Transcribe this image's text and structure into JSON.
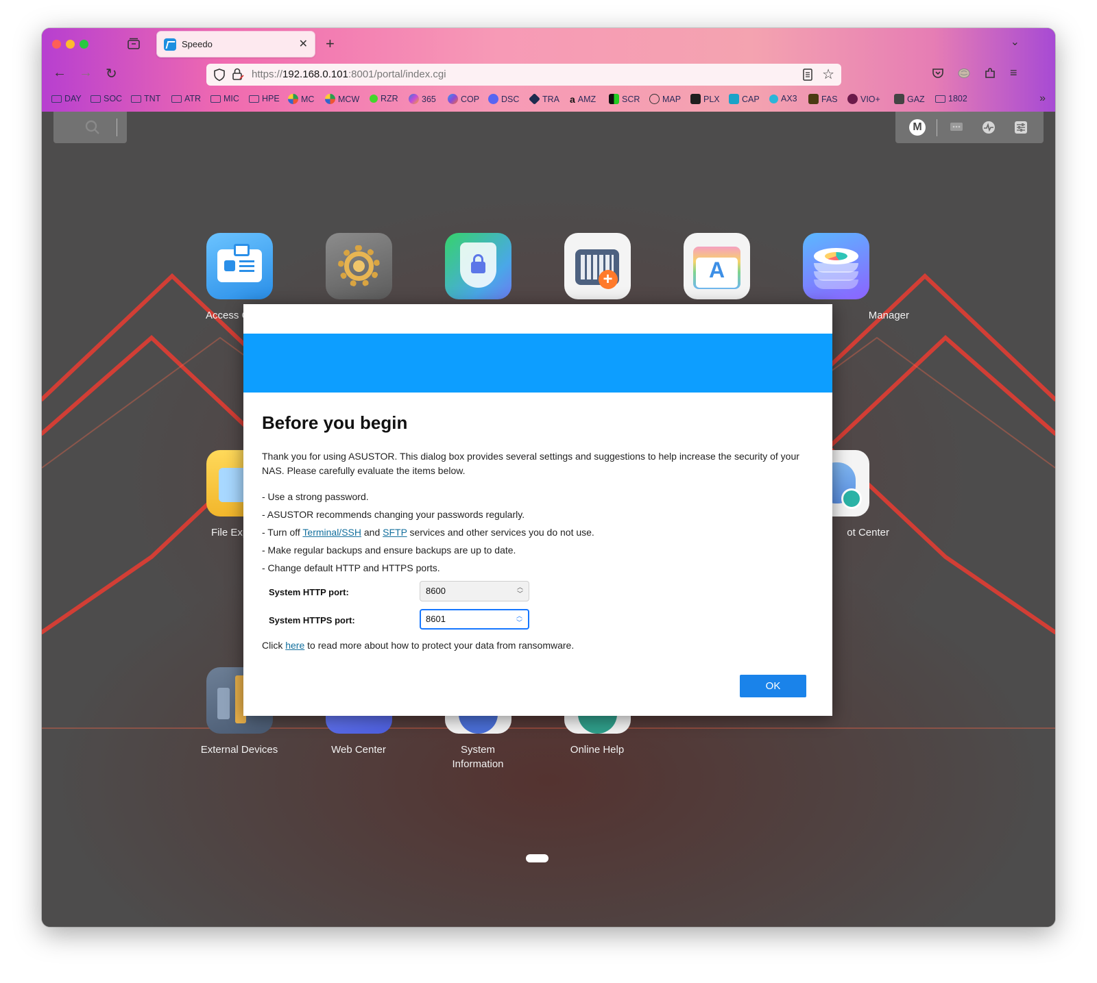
{
  "browser": {
    "tab_title": "Speedo",
    "url_prefix": "https://",
    "url_host": "192.168.0.101",
    "url_rest": ":8001/portal/index.cgi",
    "bookmarks": [
      "DAY",
      "SOC",
      "TNT",
      "ATR",
      "MIC",
      "HPE",
      "MC",
      "MCW",
      "RZR",
      "365",
      "COP",
      "DSC",
      "TRA",
      "AMZ",
      "SCR",
      "MAP",
      "PLX",
      "CAP",
      "AX3",
      "FAS",
      "VIO+",
      "GAZ",
      "1802"
    ]
  },
  "desktop": {
    "user_initial": "M",
    "apps_row1": [
      "Access C",
      "",
      "",
      "",
      "",
      "Manager"
    ],
    "apps_row2": [
      "File Exp",
      "ot Center"
    ],
    "apps_row3": [
      "External Devices",
      "Web Center",
      "System Information",
      "Online Help"
    ]
  },
  "dialog": {
    "title": "Before you begin",
    "intro": "Thank you for using ASUSTOR. This dialog box provides several settings and suggestions to help increase the security of your NAS. Please carefully evaluate the items below.",
    "tip1": "- Use a strong password.",
    "tip2": "- ASUSTOR recommends changing your passwords regularly.",
    "tip3_a": "- Turn off ",
    "tip3_link1": "Terminal/SSH",
    "tip3_b": " and ",
    "tip3_link2": "SFTP",
    "tip3_c": " services and other services you do not use.",
    "tip4": "- Make regular backups and ensure backups are up to date.",
    "tip5": "- Change default HTTP and HTTPS ports.",
    "http_label": "System HTTP port:",
    "http_value": "8600",
    "https_label": "System HTTPS port:",
    "https_value": "8601",
    "footer_a": "Click ",
    "footer_link": "here",
    "footer_b": " to read more about how to protect your data from ransomware.",
    "ok_label": "OK"
  },
  "colors": {
    "banner": "#0d9eff",
    "ok_button": "#1a83ea",
    "link": "#136f9d"
  }
}
